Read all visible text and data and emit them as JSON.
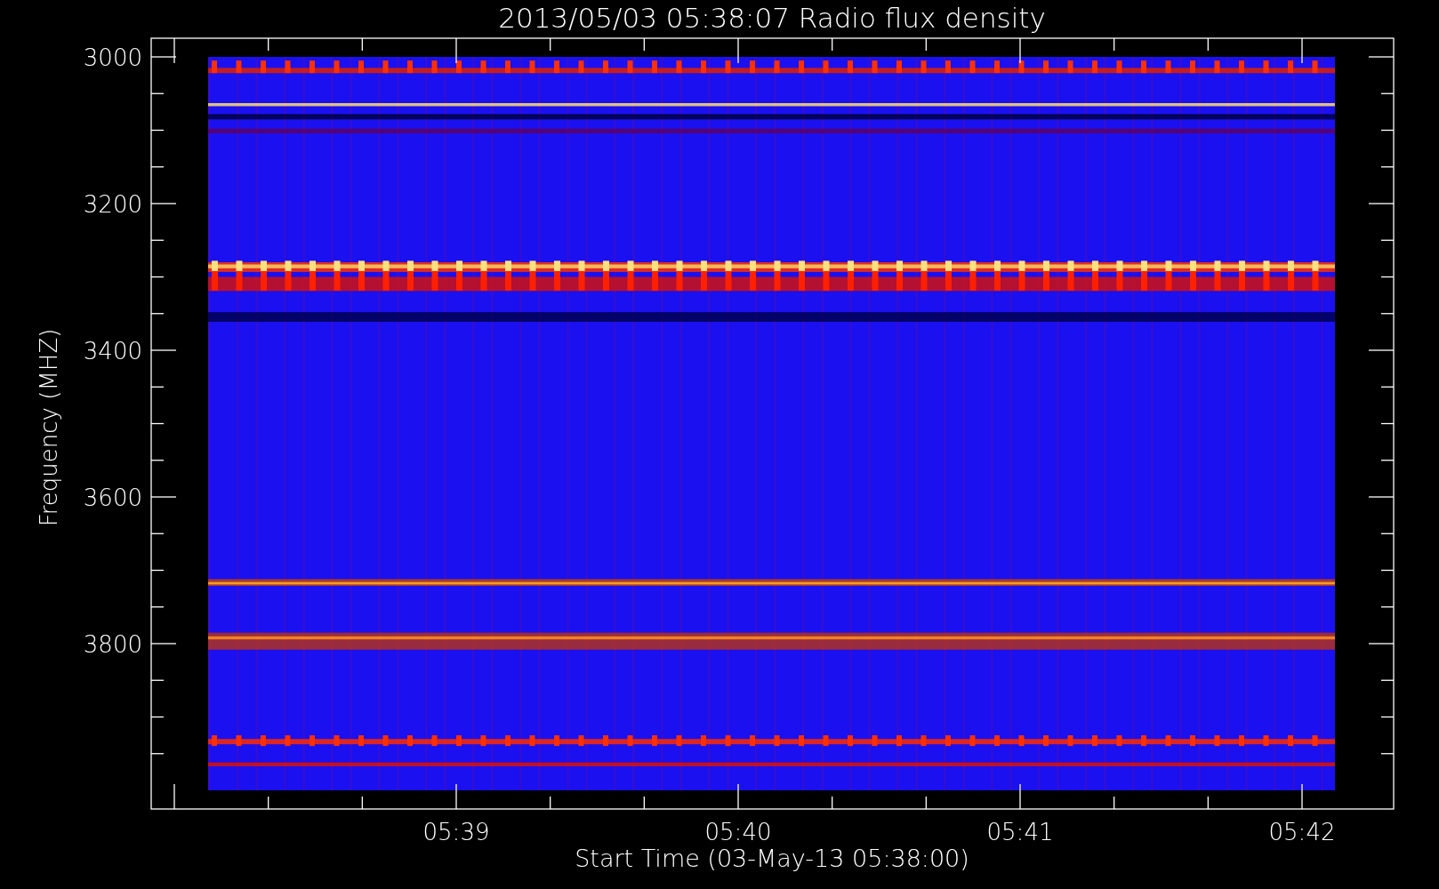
{
  "title": "2013/05/03 05:38:07 Radio flux density",
  "y_axis": {
    "label": "Frequency (MHZ)",
    "ticks": [
      "3000",
      "3200",
      "3400",
      "3600",
      "3800"
    ]
  },
  "x_axis": {
    "label": "Start Time (03-May-13 05:38:00)",
    "ticks": [
      "05:39",
      "05:40",
      "05:41",
      "05:42"
    ]
  }
}
